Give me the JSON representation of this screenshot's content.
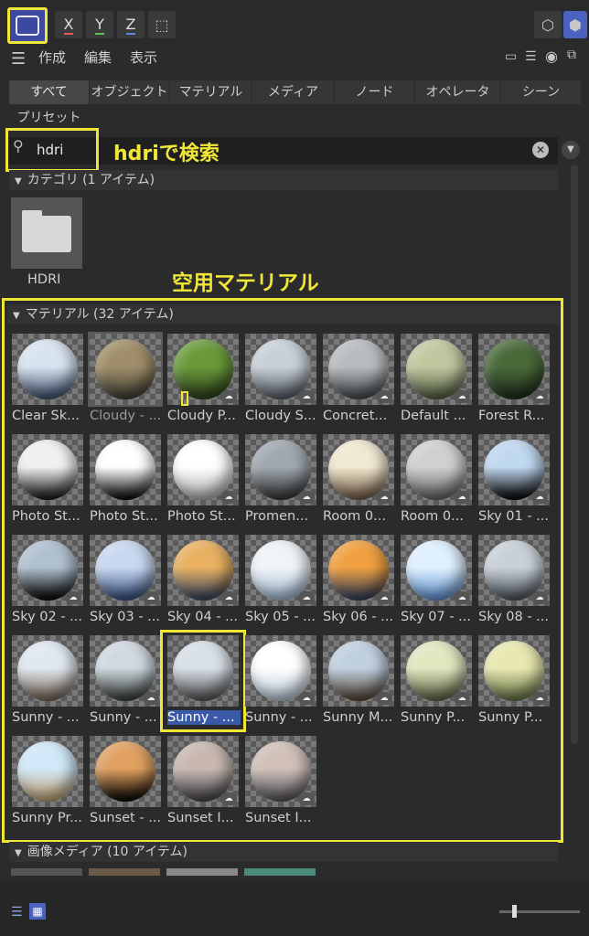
{
  "toolbar": {
    "axes": [
      {
        "label": "X",
        "color": "#e05a5a"
      },
      {
        "label": "Y",
        "color": "#5ac35a"
      },
      {
        "label": "Z",
        "color": "#5a8ae0"
      }
    ]
  },
  "menu": {
    "create": "作成",
    "edit": "編集",
    "view": "表示"
  },
  "tabs": [
    "すべて",
    "オブジェクト",
    "マテリアル",
    "メディア",
    "ノード",
    "オペレータ",
    "シーン",
    "プリセット"
  ],
  "search": {
    "value": "hdri"
  },
  "annotations": {
    "search": "hdriで検索",
    "material": "空用マテリアル"
  },
  "category": {
    "header": "カテゴリ (1 アイテム)",
    "folder_label": "HDRI"
  },
  "materials": {
    "header": "マテリアル (32 アイテム)",
    "items": [
      {
        "label": "Clear Sk...",
        "c1": "#d8e4f0",
        "c2": "#3a4c6a",
        "cloud": false
      },
      {
        "label": "Cloudy - ...",
        "c1": "#a08e6a",
        "c2": "#3c3a30",
        "cloud": false
      },
      {
        "label": "Cloudy P...",
        "c1": "#6a9a3a",
        "c2": "#2a3a1a",
        "cloud": true
      },
      {
        "label": "Cloudy S...",
        "c1": "#c8d0d8",
        "c2": "#505860",
        "cloud": true
      },
      {
        "label": "Concret...",
        "c1": "#b8bcc0",
        "c2": "#404448",
        "cloud": true
      },
      {
        "label": "Default ...",
        "c1": "#c0c8a0",
        "c2": "#505a40",
        "cloud": true
      },
      {
        "label": "Forest R...",
        "c1": "#4a6a3a",
        "c2": "#1a2a1a",
        "cloud": true
      },
      {
        "label": "Photo St...",
        "c1": "#f0f0f0",
        "c2": "#101010",
        "cloud": false
      },
      {
        "label": "Photo St...",
        "c1": "#ffffff",
        "c2": "#000000",
        "cloud": false
      },
      {
        "label": "Photo St...",
        "c1": "#ffffff",
        "c2": "#b0b0b0",
        "cloud": true
      },
      {
        "label": "Promen...",
        "c1": "#a0a8b0",
        "c2": "#303030",
        "cloud": true
      },
      {
        "label": "Room 0...",
        "c1": "#f0e8d0",
        "c2": "#705840",
        "cloud": true
      },
      {
        "label": "Room 0...",
        "c1": "#d0d0d0",
        "c2": "#606060",
        "cloud": true
      },
      {
        "label": "Sky 01 - ...",
        "c1": "#c0d8f0",
        "c2": "#000000",
        "cloud": true
      },
      {
        "label": "Sky 02 - ...",
        "c1": "#b0c0d0",
        "c2": "#000000",
        "cloud": true
      },
      {
        "label": "Sky 03 - ...",
        "c1": "#c8d8f0",
        "c2": "#304a7a",
        "cloud": true
      },
      {
        "label": "Sky 04 - ...",
        "c1": "#e8b060",
        "c2": "#304060",
        "cloud": true
      },
      {
        "label": "Sky 05 - ...",
        "c1": "#f0f4f8",
        "c2": "#a0b8d0",
        "cloud": true
      },
      {
        "label": "Sky 06 - ...",
        "c1": "#f0a040",
        "c2": "#2a3a5a",
        "cloud": true
      },
      {
        "label": "Sky 07 - ...",
        "c1": "#e0f0ff",
        "c2": "#5a90d0",
        "cloud": true
      },
      {
        "label": "Sky 08 - ...",
        "c1": "#c8d0d8",
        "c2": "#485058",
        "cloud": true
      },
      {
        "label": "Sunny - ...",
        "c1": "#e0e8f0",
        "c2": "#706050",
        "cloud": false
      },
      {
        "label": "Sunny - ...",
        "c1": "#d0d8e0",
        "c2": "#303830",
        "cloud": true
      },
      {
        "label": "Sunny - ...",
        "c1": "#d8e0e8",
        "c2": "#505050",
        "cloud": false
      },
      {
        "label": "Sunny - ...",
        "c1": "#ffffff",
        "c2": "#b8c8d8",
        "cloud": true
      },
      {
        "label": "Sunny M...",
        "c1": "#c0d0e0",
        "c2": "#504030",
        "cloud": true
      },
      {
        "label": "Sunny P...",
        "c1": "#e0e8c0",
        "c2": "#5a6040",
        "cloud": true
      },
      {
        "label": "Sunny P...",
        "c1": "#e8e8b0",
        "c2": "#607040",
        "cloud": true
      },
      {
        "label": "Sunny Pr...",
        "c1": "#d0e8f8",
        "c2": "#c0a070",
        "cloud": false
      },
      {
        "label": "Sunset - ...",
        "c1": "#e0a060",
        "c2": "#000000",
        "cloud": false
      },
      {
        "label": "Sunset I...",
        "c1": "#c8b8b0",
        "c2": "#404048",
        "cloud": true
      },
      {
        "label": "Sunset I...",
        "c1": "#d0c0b8",
        "c2": "#505058",
        "cloud": true
      }
    ]
  },
  "image_media": {
    "header": "画像メディア (10 アイテム)"
  },
  "colors": {
    "accent": "#f0e637",
    "bg": "#2b2b2b",
    "selected_label_bg": "#3a5aa8"
  }
}
